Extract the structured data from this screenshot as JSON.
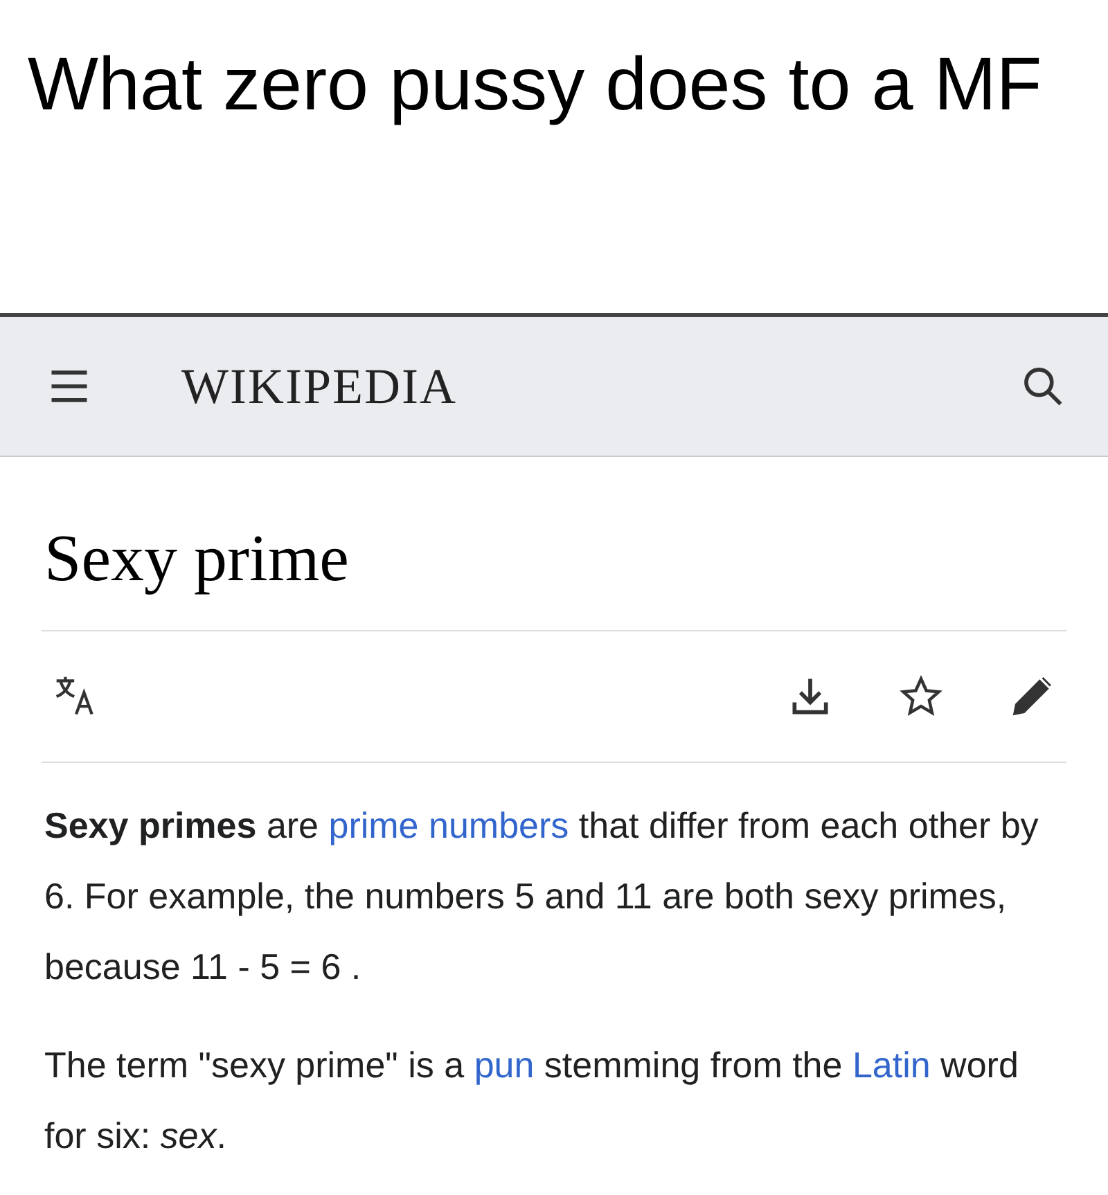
{
  "caption": "What zero pussy does to a MF",
  "header": {
    "wordmark": "WIKIPEDIA"
  },
  "article": {
    "title": "Sexy prime",
    "paragraphs": [
      [
        {
          "kind": "bold",
          "text": "Sexy primes"
        },
        {
          "kind": "plain",
          "text": " are "
        },
        {
          "kind": "link",
          "text": "prime numbers"
        },
        {
          "kind": "plain",
          "text": " that differ from each other by 6. For example, the numbers 5 and 11 are both sexy primes, because 11 - 5 = 6 ."
        }
      ],
      [
        {
          "kind": "plain",
          "text": "The term \"sexy prime\" is a "
        },
        {
          "kind": "link",
          "text": "pun"
        },
        {
          "kind": "plain",
          "text": " stemming from the "
        },
        {
          "kind": "link",
          "text": "Latin"
        },
        {
          "kind": "plain",
          "text": " word for six: "
        },
        {
          "kind": "italic",
          "text": "sex"
        },
        {
          "kind": "plain",
          "text": "."
        }
      ]
    ]
  }
}
